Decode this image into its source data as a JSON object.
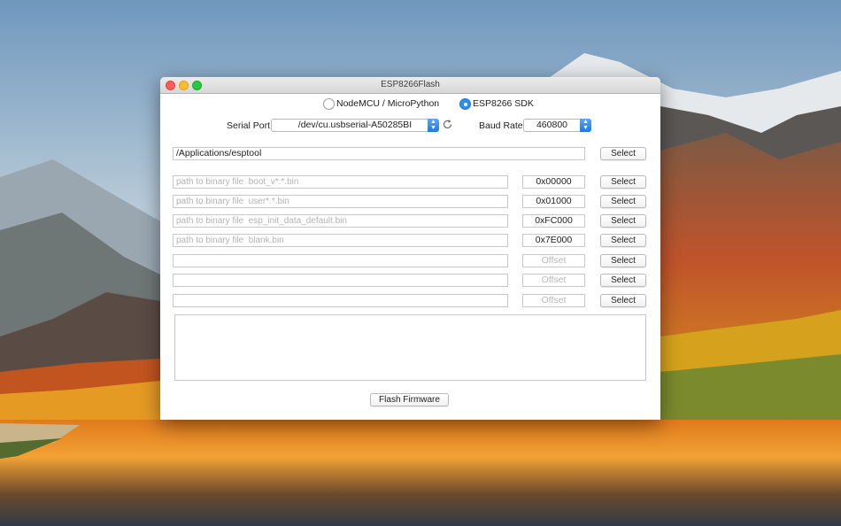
{
  "window": {
    "title": "ESP8266Flash"
  },
  "mode": {
    "options": [
      {
        "label": "NodeMCU / MicroPython",
        "selected": false
      },
      {
        "label": "ESP8266 SDK",
        "selected": true
      }
    ]
  },
  "serial": {
    "label": "Serial Port",
    "value": "/dev/cu.usbserial-A50285BI"
  },
  "baud": {
    "label": "Baud Rate",
    "value": "460800"
  },
  "esptool": {
    "path": "/Applications/esptool",
    "select_label": "Select"
  },
  "binaries": [
    {
      "placeholder": "path to binary file  boot_v*.*.bin",
      "offset": "0x00000",
      "offset_placeholder": "",
      "select_label": "Select"
    },
    {
      "placeholder": "path to binary file  user*.*.bin",
      "offset": "0x01000",
      "offset_placeholder": "",
      "select_label": "Select"
    },
    {
      "placeholder": "path to binary file  esp_init_data_default.bin",
      "offset": "0xFC000",
      "offset_placeholder": "",
      "select_label": "Select"
    },
    {
      "placeholder": "path to binary file  blank.bin",
      "offset": "0x7E000",
      "offset_placeholder": "",
      "select_label": "Select"
    },
    {
      "placeholder": "",
      "offset": "",
      "offset_placeholder": "Offset",
      "select_label": "Select"
    },
    {
      "placeholder": "",
      "offset": "",
      "offset_placeholder": "Offset",
      "select_label": "Select"
    },
    {
      "placeholder": "",
      "offset": "",
      "offset_placeholder": "Offset",
      "select_label": "Select"
    }
  ],
  "actions": {
    "flash_label": "Flash Firmware"
  },
  "icons": {
    "refresh": "refresh-icon",
    "popup_arrows": "updown-chevron-icon"
  },
  "colors": {
    "accent": "#2b8cf3",
    "close": "#fd5f57",
    "minimize": "#febc2e",
    "maximize": "#28c840"
  }
}
